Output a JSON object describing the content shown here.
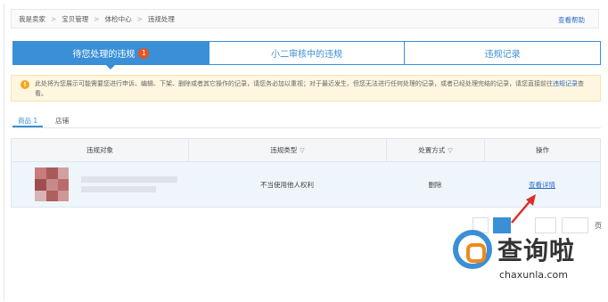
{
  "breadcrumb": [
    "我是卖家",
    "宝贝管理",
    "体检中心",
    "违规处理"
  ],
  "help_link": "查看帮助",
  "tabs": [
    {
      "label": "待您处理的违规",
      "badge": "1",
      "active": true
    },
    {
      "label": "小二审核中的违规",
      "active": false
    },
    {
      "label": "违规记录",
      "active": false
    }
  ],
  "notice": {
    "text": "此处将为您展示可能需要您进行申诉、编辑、下架、删除或者其它操作的记录，请您务必加以重视；对于最近发生、但您无法进行任何处理的记录，或者已经处理完结的记录，请您直接前往",
    "link": "违规记录",
    "suffix": "查看。"
  },
  "subtabs": [
    "商品 1",
    "店铺"
  ],
  "table": {
    "headers": [
      "违规对象",
      "违规类型",
      "处置方式",
      "操作"
    ],
    "row": {
      "type": "不当使用他人权利",
      "action": "删除",
      "operation": "查看详情"
    }
  },
  "pagination_suffix": "页",
  "watermark": {
    "title": "查询啦",
    "url": "chaxunla.com"
  },
  "colors": {
    "accent": "#3a8fd6",
    "badge": "#e8531e",
    "notice_bg": "#fff6e0",
    "arrow": "#d9302b"
  }
}
